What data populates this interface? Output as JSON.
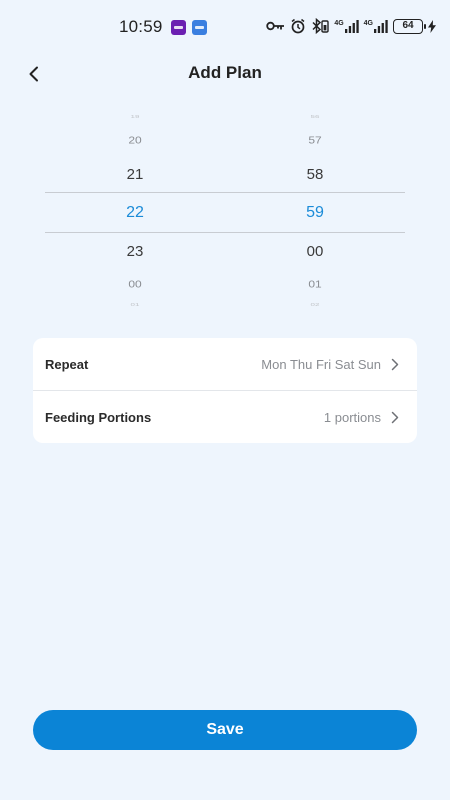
{
  "status_bar": {
    "time": "10:59",
    "net_label_1": "4G",
    "net_label_2": "4G",
    "battery": "64",
    "icons": [
      "purple-app-icon",
      "blue-app-icon",
      "key-icon",
      "alarm-icon",
      "bluetooth-icon",
      "signal-icon",
      "signal-icon",
      "battery-icon",
      "charging-icon"
    ]
  },
  "header": {
    "title": "Add Plan",
    "back_icon": "chevron-left-icon"
  },
  "time_picker": {
    "hours": [
      "19",
      "20",
      "21",
      "22",
      "23",
      "00",
      "01"
    ],
    "minutes": [
      "56",
      "57",
      "58",
      "59",
      "00",
      "01",
      "02"
    ],
    "selected_hour": "22",
    "selected_minute": "59",
    "selected_color": "#1a8bd8"
  },
  "settings": {
    "repeat": {
      "label": "Repeat",
      "value": "Mon Thu Fri Sat Sun"
    },
    "portions": {
      "label": "Feeding Portions",
      "value": "1 portions"
    }
  },
  "save_button": {
    "label": "Save"
  },
  "colors": {
    "background": "#eef5fd",
    "accent": "#0b84d6",
    "card": "#ffffff"
  }
}
